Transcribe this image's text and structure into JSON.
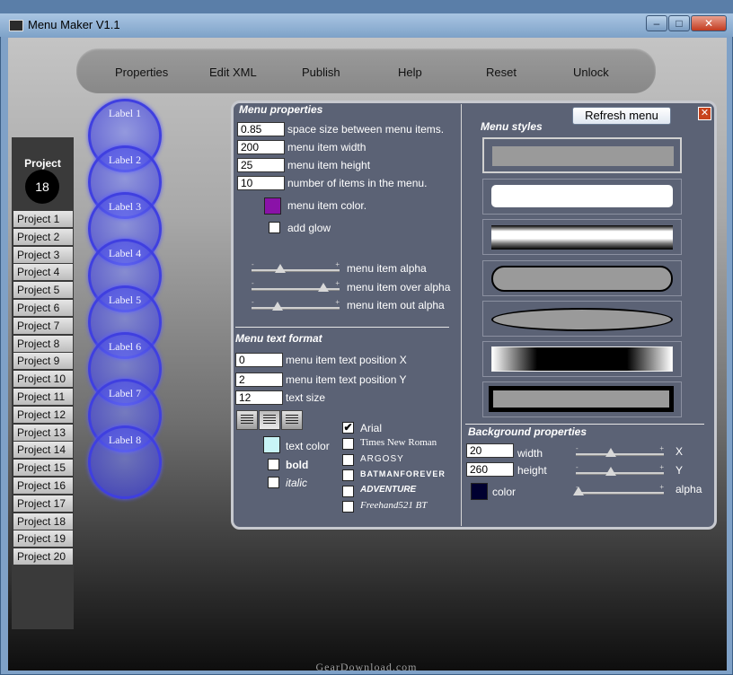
{
  "window": {
    "title": "Menu Maker V1.1",
    "controls": {
      "minimize": "–",
      "maximize": "□",
      "close": "✕"
    }
  },
  "top_menu": [
    "Properties",
    "Edit XML",
    "Publish",
    "Help",
    "Reset",
    "Unlock"
  ],
  "projects": {
    "header": "Project",
    "count": "18",
    "items": [
      "Project 1",
      "Project 2",
      "Project 3",
      "Project 4",
      "Project 5",
      "Project 6",
      "Project 7",
      "Project 8",
      "Project 9",
      "Project 10",
      "Project 11",
      "Project 12",
      "Project 13",
      "Project 14",
      "Project 15",
      "Project 16",
      "Project 17",
      "Project 18",
      "Project 19",
      "Project 20"
    ]
  },
  "preview_labels": [
    "Label 1",
    "Label 2",
    "Label 3",
    "Label 4",
    "Label 5",
    "Label 6",
    "Label 7",
    "Label 8"
  ],
  "menu_properties": {
    "title": "Menu properties",
    "space_size": {
      "value": "0.85",
      "label": "space size between menu items."
    },
    "item_width": {
      "value": "200",
      "label": "menu item width"
    },
    "item_height": {
      "value": "25",
      "label": "menu item height"
    },
    "item_count": {
      "value": "10",
      "label": "number of items in the menu."
    },
    "item_color": {
      "label": "menu item color.",
      "color": "#8a12a8"
    },
    "add_glow": {
      "label": "add glow",
      "checked": false
    },
    "alpha": {
      "label": "menu item alpha",
      "level": 0.33
    },
    "over_alpha": {
      "label": "menu item over alpha",
      "level": 0.82
    },
    "out_alpha": {
      "label": "menu item out alpha",
      "level": 0.3
    }
  },
  "text_format": {
    "title": "Menu text format",
    "pos_x": {
      "value": "0",
      "label": "menu item text position X"
    },
    "pos_y": {
      "value": "2",
      "label": "menu item text position Y"
    },
    "text_size": {
      "value": "12",
      "label": "text size"
    },
    "text_color": {
      "label": "text color",
      "color": "#c8f4f6"
    },
    "bold": {
      "label": "bold",
      "checked": false
    },
    "italic": {
      "label": "italic",
      "checked": false
    },
    "fonts": [
      {
        "name": "Arial",
        "checked": true
      },
      {
        "name": "Times New Roman",
        "checked": false
      },
      {
        "name": "ARGOSY",
        "checked": false
      },
      {
        "name": "BATMANFOREVER",
        "checked": false
      },
      {
        "name": "ADVENTURE",
        "checked": false
      },
      {
        "name": "Freehand521 BT",
        "checked": false
      }
    ]
  },
  "menu_styles": {
    "title": "Menu styles",
    "refresh_label": "Refresh menu",
    "close_glyph": "✕"
  },
  "background": {
    "title": "Background  properties",
    "width": {
      "value": "20",
      "label": "width"
    },
    "height": {
      "value": "260",
      "label": "height"
    },
    "color": {
      "label": "color",
      "color": "#000030"
    },
    "x_slider": {
      "label": "X",
      "level": 0.4
    },
    "y_slider": {
      "label": "Y",
      "level": 0.4
    },
    "alpha_slider": {
      "label": "alpha",
      "level": 0.03
    }
  },
  "watermark": "GearDownload.com"
}
